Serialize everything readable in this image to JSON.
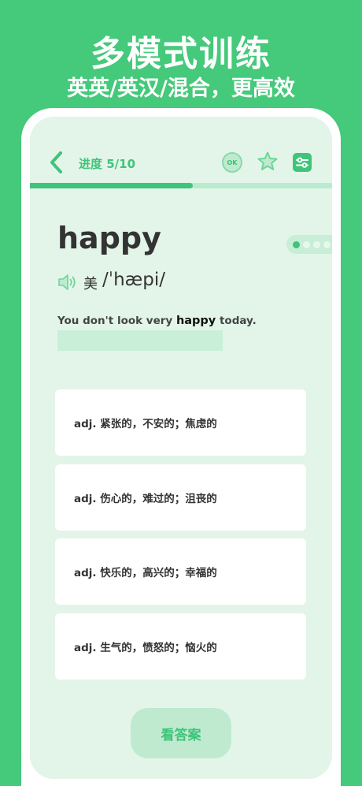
{
  "promo": {
    "title": "多模式训练",
    "subtitle": "英英/英汉/混合，更高效"
  },
  "header": {
    "progress_label": "进度 5/10",
    "ok_label": "OK",
    "progress_fraction": 0.54
  },
  "word": {
    "text": "happy",
    "pron_region": "美",
    "phonetic": "/ˈhæpi/"
  },
  "example": {
    "before": "You don't look very ",
    "highlight": "happy",
    "after": " today."
  },
  "options": [
    "adj. 紧张的，不安的；焦虑的",
    "adj. 伤心的，难过的；沮丧的",
    "adj.  快乐的，高兴的；幸福的",
    "adj. 生气的，愤怒的；恼火的"
  ],
  "answer_button": "看答案",
  "colors": {
    "brand": "#45c97a",
    "accent": "#3fc47a",
    "screen_bg": "#e3f5e9"
  }
}
